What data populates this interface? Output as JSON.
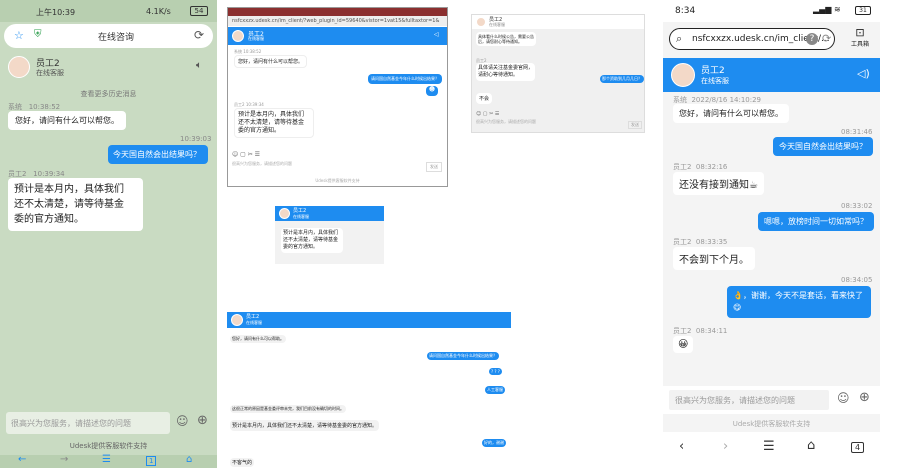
{
  "left": {
    "status_time": "上午10:39",
    "status_right": "4.1K/s",
    "status_battery": "54",
    "url_text": "在线咨询",
    "agent_name": "员工2",
    "agent_status": "在线客服",
    "hint": "查看更多历史消息",
    "sys_label": "系统",
    "sys_time": "10:38:52",
    "sys_msg": "您好，请问有什么可以帮您。",
    "user_time": "10:39:03",
    "user_msg": "今天国自然会出结果吗？",
    "agent_label": "员工2",
    "agent_time": "10:39:34",
    "agent_msg": "预计是本月内，具体我们\n还不太清楚，请等待基金\n委的官方通知。",
    "input_placeholder": "很高兴为您服务，请描述您的问题",
    "footer": "Udesk提供客服软件支持",
    "nav_count": "1"
  },
  "desktop": {
    "tab_title": "Udesk",
    "url": "nsfcxxzx.udesk.cn/im_client/?web_plugin_id=59640&vistor=1vat15&fulltaxtor=1&",
    "agent_name": "员工2",
    "agent_status": "在线客服",
    "sys_label": "系统",
    "sys_time": "10:38:52",
    "sys_msg": "您好，请问有什么可以帮您。",
    "user_time": "10:39:03",
    "user_msg": "请问国自然基金今年什么时候出结果？",
    "agent_label": "员工2",
    "agent_time": "10:39:34",
    "agent_msg": "预计是本月内，具体我们\n还不太清楚，请等待基金\n委的官方通知。",
    "input_placeholder": "很高兴为您服务，请描述您的问题",
    "send": "发送",
    "footer": "Udesk提供客服软件支持"
  },
  "small_mid": {
    "agent_name": "员工2",
    "agent_status": "在线客服",
    "msg": "预计是本月内，具体我们\n还不太清楚，请等待基金\n委的官方通知。"
  },
  "top_mid": {
    "agent_name": "员工2",
    "agent_status": "在线客服",
    "msg_top": "具体看什么时候公告，需要公告\n后，请您耐心等待通知。",
    "msg1_label": "员工2",
    "msg1": "具体请关注基金委官网，\n请耐心等待通知。",
    "user_msg": "那个资助到几月几日？",
    "msg2": "不会",
    "input_placeholder": "很高兴为您服务，请描述您的问题",
    "send": "发送"
  },
  "bottom_mid": {
    "agent_name": "员工2",
    "agent_status": "在线客服",
    "sys_msg": "您好，请问有什么可以帮助。",
    "user_msg1": "请问国自然基金今年什么时候出结果？",
    "user_msg2": "? ? ?",
    "user_msg3": "人工客服",
    "agent_msg1": "这很正常的原因是基金委评审未完，我们目前没有确切的时间。",
    "agent_msg2": "预计是本月内，具体我们还不太清楚，请等待基金委的官方通知。",
    "user_msg4": "好的，谢谢",
    "agent_msg3": "不客气的"
  },
  "right": {
    "status_time": "8:34",
    "status_battery": "31",
    "url": "nsfcxxzx.udesk.cn/im_client/...",
    "toolbox": "工具箱",
    "agent_name": "员工2",
    "agent_status": "在线客服",
    "sys_label": "系统",
    "sys_time": "2022/8/16 14:10:29",
    "sys_msg": "您好，请问有什么可以帮您。",
    "t1": "08:31:46",
    "u1": "今天国自然会出结果吗？",
    "a1_label": "员工2",
    "a1_time": "08:32:16",
    "a1": "还没有接到通知☕",
    "t2": "08:33:02",
    "u2": "嗯嗯，放榜时间一切如常吗？",
    "a2_label": "员工2",
    "a2_time": "08:33:35",
    "a2": "不会到下个月。",
    "t3": "08:34:05",
    "u3": "👌，谢谢，今天不是套话，看来快了😋",
    "a3_label": "员工2",
    "a3_time": "08:34:11",
    "a3": "😀",
    "input_placeholder": "很高兴为您服务，请描述您的问题",
    "footer": "Udesk提供客服软件支持",
    "tab_count": "4"
  },
  "colors": {
    "accent": "#1e8cf0",
    "green_bg": "#c7d9bf"
  }
}
